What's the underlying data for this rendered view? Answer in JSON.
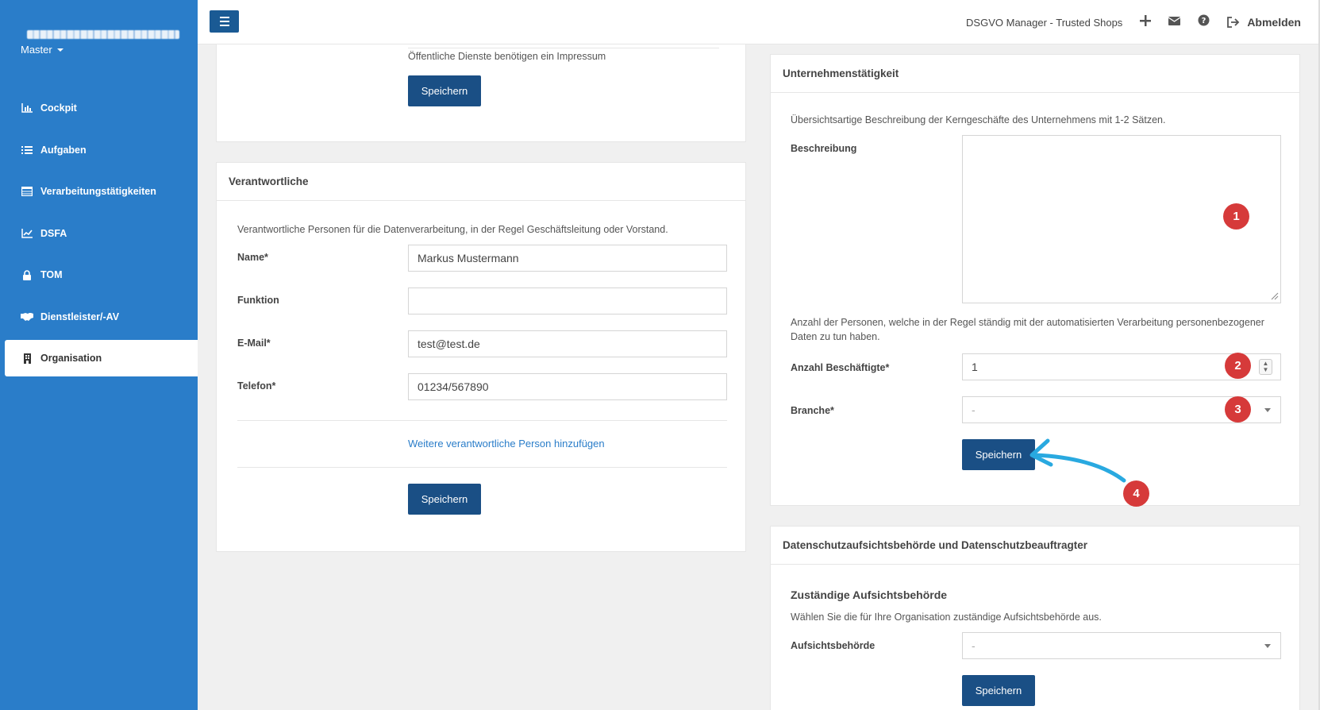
{
  "sidebar": {
    "user_label": "Master",
    "items": [
      {
        "label": "Cockpit",
        "icon": "chart-icon"
      },
      {
        "label": "Aufgaben",
        "icon": "list-icon"
      },
      {
        "label": "Verarbeitungstätigkeiten",
        "icon": "table-icon"
      },
      {
        "label": "DSFA",
        "icon": "line-chart-icon"
      },
      {
        "label": "TOM",
        "icon": "lock-icon"
      },
      {
        "label": "Dienstleister/-AV",
        "icon": "handshake-icon"
      },
      {
        "label": "Organisation",
        "icon": "building-icon",
        "active": true
      }
    ]
  },
  "topbar": {
    "title": "DSGVO Manager - Trusted Shops",
    "logout_label": "Abmelden"
  },
  "impressum": {
    "note": "Öffentliche Dienste benötigen ein Impressum",
    "save_label": "Speichern"
  },
  "verantwortliche": {
    "heading": "Verantwortliche",
    "description": "Verantwortliche Personen für die Datenverarbeitung, in der Regel Geschäftsleitung oder Vorstand.",
    "fields": {
      "name": {
        "label": "Name*",
        "value": "Markus Mustermann"
      },
      "funktion": {
        "label": "Funktion",
        "value": ""
      },
      "email": {
        "label": "E-Mail*",
        "value": "test@test.de"
      },
      "telefon": {
        "label": "Telefon*",
        "value": "01234/567890"
      }
    },
    "add_link": "Weitere verantwortliche Person hinzufügen",
    "save_label": "Speichern"
  },
  "unternehmen": {
    "heading": "Unternehmenstätigkeit",
    "description": "Übersichtsartige Beschreibung der Kerngeschäfte des Unternehmens mit 1-2 Sätzen.",
    "beschreibung_label": "Beschreibung",
    "beschreibung_value": "",
    "persons_text": "Anzahl der Personen, welche in der Regel ständig mit der automatisierten Verarbeitung personenbezogener Daten zu tun haben.",
    "employees_label": "Anzahl Beschäftigte*",
    "employees_value": "1",
    "branche_label": "Branche*",
    "branche_value": "-",
    "save_label": "Speichern"
  },
  "datenschutz": {
    "heading": "Datenschutzaufsichtsbehörde und Datenschutzbeauftragter",
    "subheading": "Zuständige Aufsichtsbehörde",
    "description": "Wählen Sie die für Ihre Organisation zuständige Aufsichtsbehörde aus.",
    "authority_label": "Aufsichtsbehörde",
    "authority_value": "-",
    "save_label": "Speichern"
  },
  "annotations": {
    "badge1": "1",
    "badge2": "2",
    "badge3": "3",
    "badge4": "4",
    "badge_color": "#d63a3a",
    "arrow_color": "#29a9e0"
  }
}
